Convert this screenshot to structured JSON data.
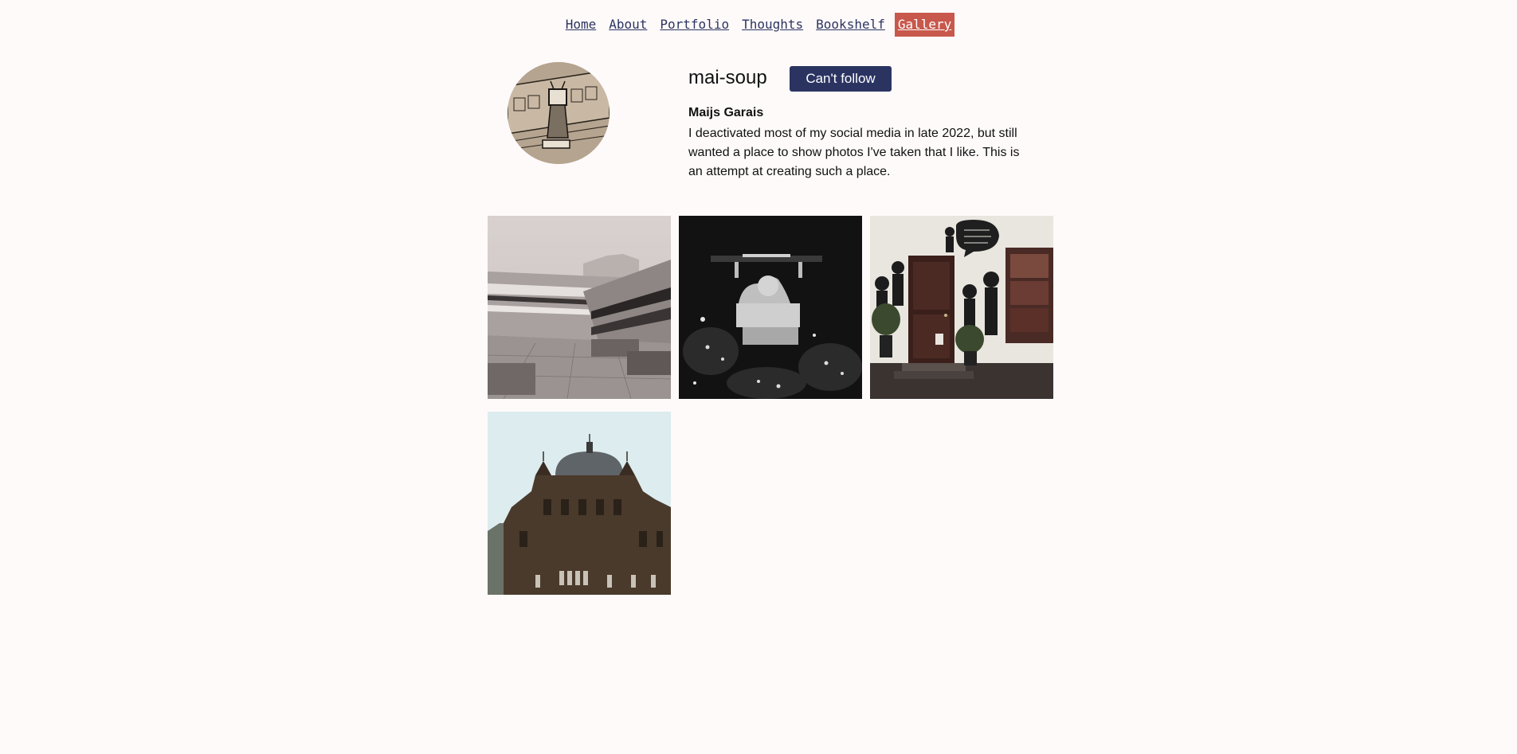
{
  "nav": {
    "items": [
      {
        "label": "Home"
      },
      {
        "label": "About"
      },
      {
        "label": "Portfolio"
      },
      {
        "label": "Thoughts"
      },
      {
        "label": "Bookshelf"
      },
      {
        "label": "Gallery",
        "active": true
      }
    ]
  },
  "profile": {
    "username": "mai-soup",
    "follow_label": "Can't follow",
    "full_name": "Maijs Garais",
    "bio": "I deactivated most of my social media in late 2022, but still wanted a place to show photos I've taken that I like. This is an attempt at creating such a place."
  },
  "gallery": {
    "photos": [
      {
        "subject": "brutalist-building-courtyard"
      },
      {
        "subject": "lion-statue-at-night"
      },
      {
        "subject": "mural-doorway"
      },
      {
        "subject": "ornate-domed-building"
      }
    ]
  },
  "colors": {
    "background": "#fffafa",
    "accent": "#c8584c",
    "primary": "#2b3461"
  }
}
